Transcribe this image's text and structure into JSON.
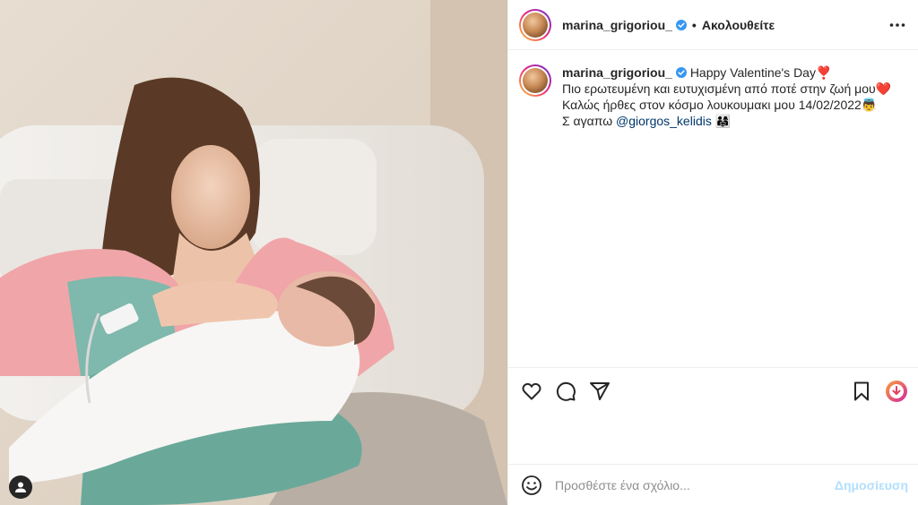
{
  "post": {
    "username": "marina_grigoriou_",
    "follow_label": "Ακολουθείτε",
    "caption": {
      "line1": "Happy Valentine's Day❣️",
      "line2": "Πιο ερωτευμένη και ευτυχισμένη από ποτέ στην ζωή μου❤️",
      "line3": "Καλώς ήρθες στον κόσμο λουκουμακι μου 14/02/2022👼",
      "line4_prefix": "Σ αγαπω ",
      "mention": "@giorgos_kelidis",
      "line4_suffix": " 👨‍👩‍👧"
    }
  },
  "comment": {
    "placeholder": "Προσθέστε ένα σχόλιο...",
    "post_label": "Δημοσίευση"
  },
  "icons": {
    "verified": "verified-badge-icon",
    "more": "more-options-icon",
    "like": "heart-icon",
    "comment": "comment-bubble-icon",
    "share": "paper-plane-icon",
    "save": "bookmark-icon",
    "extension": "download-extension-icon",
    "emoji": "smiley-icon",
    "user_tag": "user-tag-icon"
  },
  "colors": {
    "text": "#262626",
    "link": "#00376b",
    "verified_blue": "#3897f0",
    "post_button_disabled": "#b2dffc",
    "divider": "#efefef"
  }
}
